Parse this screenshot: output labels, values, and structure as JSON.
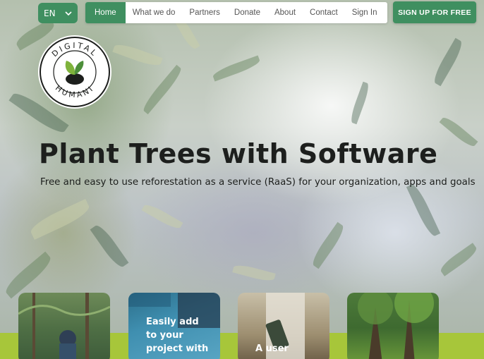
{
  "nav": {
    "language": "EN",
    "items": [
      {
        "label": "Home",
        "active": true
      },
      {
        "label": "What we do",
        "active": false
      },
      {
        "label": "Partners",
        "active": false
      },
      {
        "label": "Donate",
        "active": false
      },
      {
        "label": "About",
        "active": false
      },
      {
        "label": "Contact",
        "active": false
      },
      {
        "label": "Sign In",
        "active": false
      }
    ],
    "signup_label": "SIGN UP FOR FREE"
  },
  "logo": {
    "text_top": "DIGITAL",
    "text_bottom": "HUMANI"
  },
  "hero": {
    "title": "Plant Trees with Software",
    "subtitle": "Free and easy to use reforestation as a service (RaaS) for your organization, apps and goals"
  },
  "cards": [
    {
      "lines": []
    },
    {
      "lines": [
        "Easily add",
        "to your",
        "project with"
      ]
    },
    {
      "lines": [
        "A user"
      ]
    },
    {
      "lines": []
    }
  ],
  "colors": {
    "brand_green": "#3f8f60",
    "lime": "#a7c63a"
  }
}
